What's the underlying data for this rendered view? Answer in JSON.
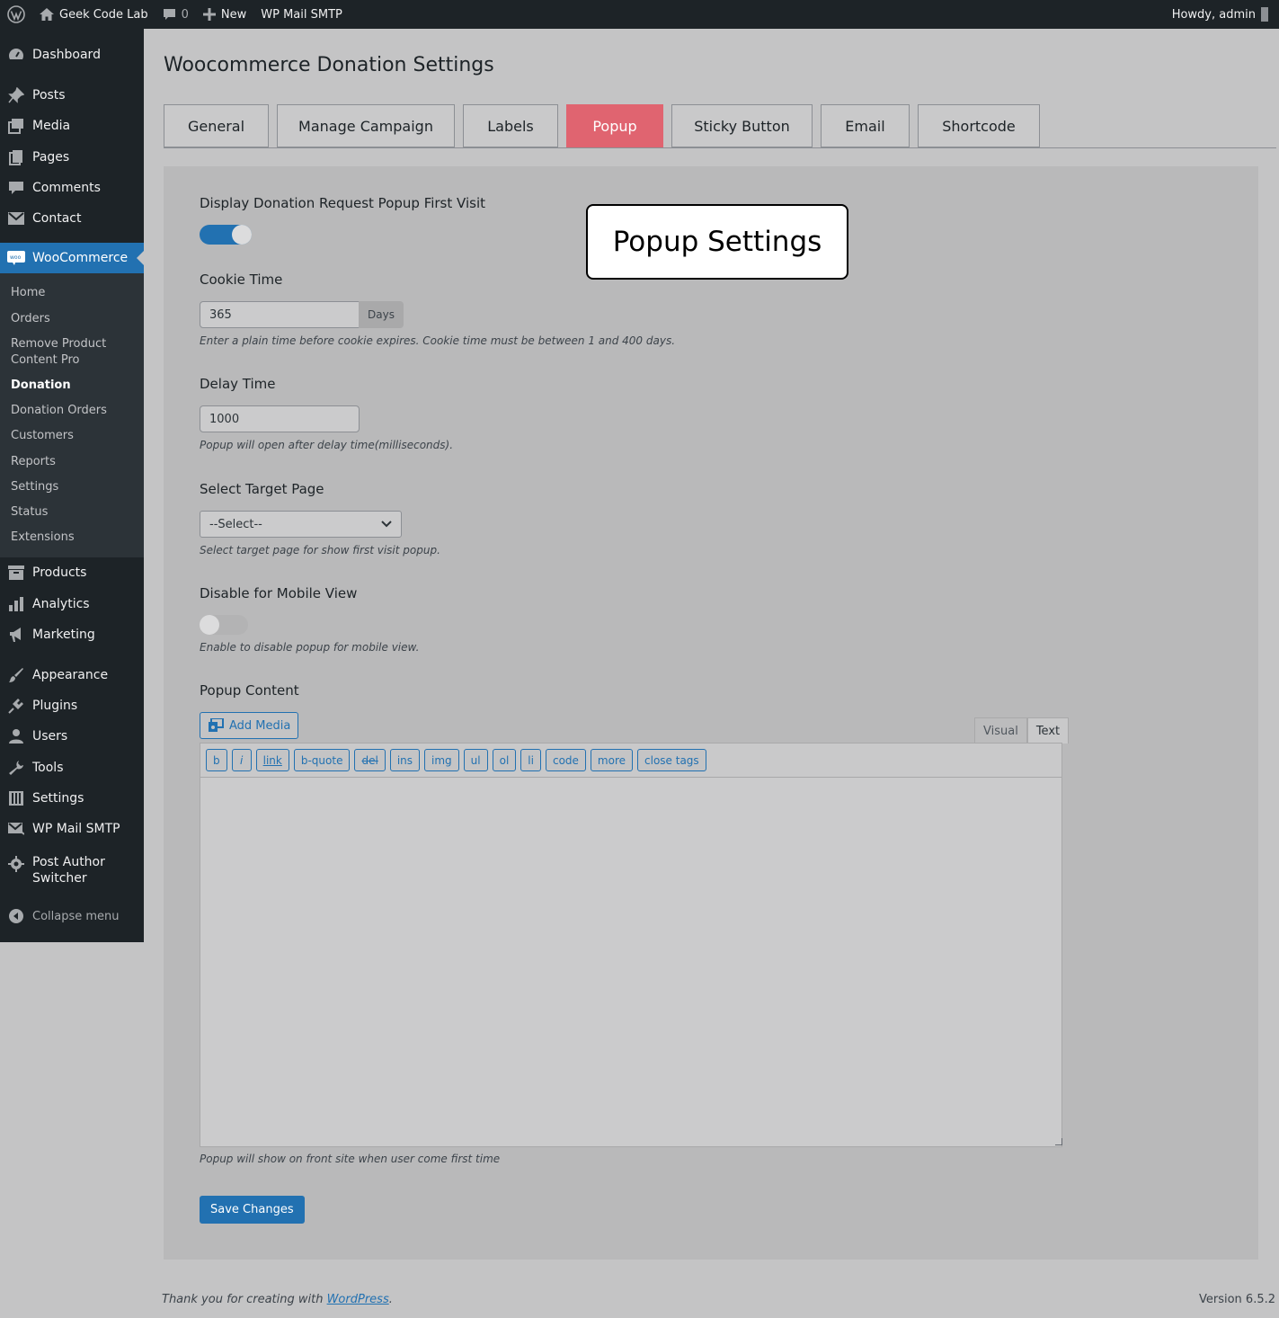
{
  "adminbar": {
    "site_name": "Geek Code Lab",
    "comments_count": "0",
    "new_label": "New",
    "plugin_link": "WP Mail SMTP",
    "howdy": "Howdy, admin"
  },
  "sidebar": {
    "items": [
      {
        "label": "Dashboard",
        "icon": "dashboard-icon"
      },
      {
        "label": "Posts",
        "icon": "pin-icon"
      },
      {
        "label": "Media",
        "icon": "media-icon"
      },
      {
        "label": "Pages",
        "icon": "pages-icon"
      },
      {
        "label": "Comments",
        "icon": "comment-icon"
      },
      {
        "label": "Contact",
        "icon": "mail-icon"
      },
      {
        "label": "WooCommerce",
        "icon": "woo-icon"
      },
      {
        "label": "Products",
        "icon": "archive-icon"
      },
      {
        "label": "Analytics",
        "icon": "chart-icon"
      },
      {
        "label": "Marketing",
        "icon": "megaphone-icon"
      },
      {
        "label": "Appearance",
        "icon": "brush-icon"
      },
      {
        "label": "Plugins",
        "icon": "plug-icon"
      },
      {
        "label": "Users",
        "icon": "user-icon"
      },
      {
        "label": "Tools",
        "icon": "wrench-icon"
      },
      {
        "label": "Settings",
        "icon": "sliders-icon"
      },
      {
        "label": "WP Mail SMTP",
        "icon": "mail-send-icon"
      },
      {
        "label": "Post Author Switcher",
        "label_line1": "Post Author",
        "label_line2": "Switcher",
        "icon": "gear-icon"
      },
      {
        "label": "Collapse menu",
        "icon": "collapse-icon"
      }
    ],
    "woo_submenu": {
      "home": "Home",
      "orders": "Orders",
      "remove_line1": "Remove Product",
      "remove_line2": "Content Pro",
      "donation": "Donation",
      "donation_orders": "Donation Orders",
      "customers": "Customers",
      "reports": "Reports",
      "settings": "Settings",
      "status": "Status",
      "extensions": "Extensions"
    }
  },
  "page": {
    "title": "Woocommerce Donation Settings",
    "tabs": [
      "General",
      "Manage Campaign",
      "Labels",
      "Popup",
      "Sticky Button",
      "Email",
      "Shortcode"
    ],
    "active_tab": "Popup",
    "callout": "Popup Settings"
  },
  "form": {
    "display_popup": {
      "label": "Display Donation Request Popup First Visit",
      "enabled": true
    },
    "cookie_time": {
      "label": "Cookie Time",
      "value": "365",
      "unit": "Days",
      "description": "Enter a plain time before cookie expires. Cookie time must be between 1 and 400 days."
    },
    "delay_time": {
      "label": "Delay Time",
      "value": "1000",
      "description": "Popup will open after delay time(milliseconds)."
    },
    "target_page": {
      "label": "Select Target Page",
      "selected": "--Select--",
      "description": "Select target page for show first visit popup."
    },
    "disable_mobile": {
      "label": "Disable for Mobile View",
      "enabled": false,
      "description": "Enable to disable popup for mobile view."
    },
    "popup_content": {
      "label": "Popup Content",
      "add_media": "Add Media",
      "editor_tabs": {
        "visual": "Visual",
        "text": "Text"
      },
      "quicktags": [
        "b",
        "i",
        "link",
        "b-quote",
        "del",
        "ins",
        "img",
        "ul",
        "ol",
        "li",
        "code",
        "more",
        "close tags"
      ],
      "value": "",
      "description": "Popup will show on front site when user come first time"
    },
    "save_label": "Save Changes"
  },
  "footer": {
    "thanks_prefix": "Thank you for creating with ",
    "wp_link": "WordPress",
    "thanks_suffix": ".",
    "version": "Version 6.5.2"
  },
  "colors": {
    "accent": "#2271b1",
    "active_tab": "#e06470",
    "sidebar_bg": "#1d2327"
  }
}
